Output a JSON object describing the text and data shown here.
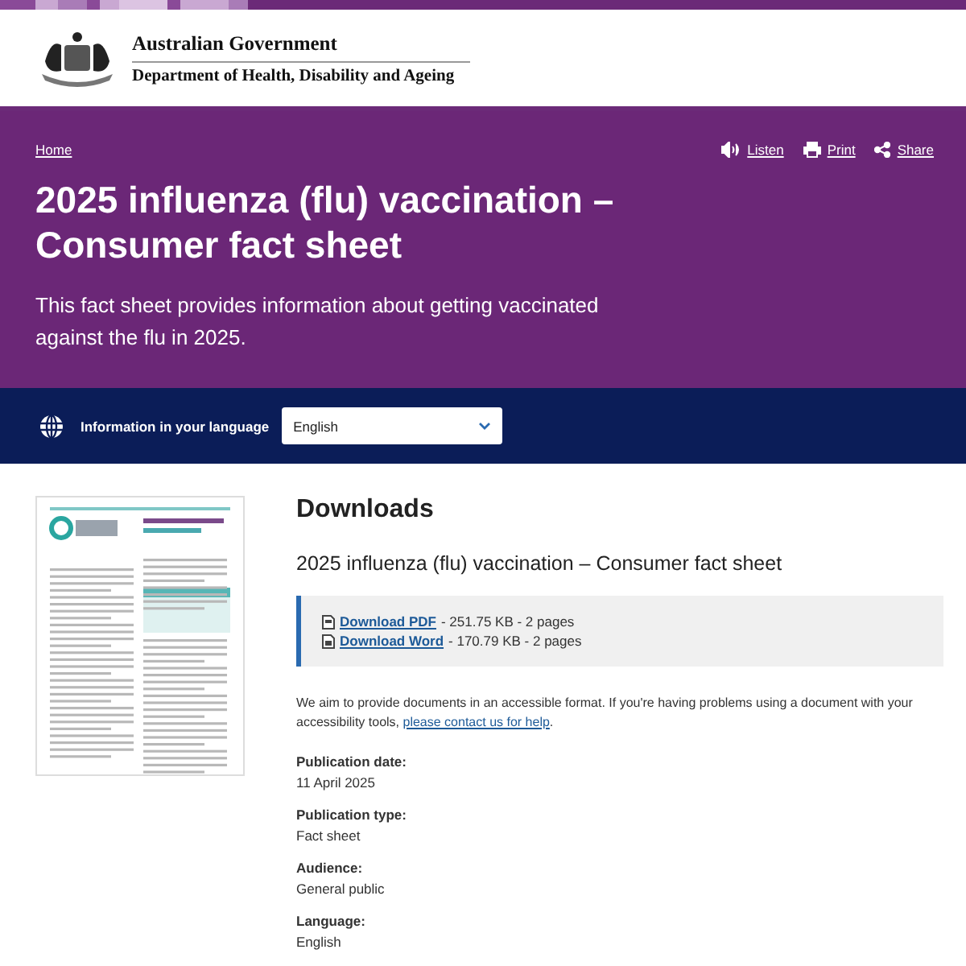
{
  "header": {
    "line_1": "Australian Government",
    "line_2": "Department of Health, Disability and Ageing"
  },
  "hero": {
    "breadcrumb": "Home",
    "actions": [
      {
        "kind": "listen",
        "label": "Listen"
      },
      {
        "kind": "print",
        "label": "Print"
      },
      {
        "kind": "share",
        "label": "Share"
      }
    ],
    "title": "2025 influenza (flu) vaccination – Consumer fact sheet",
    "summary": "This fact sheet provides information about getting vaccinated against the flu in 2025."
  },
  "language_bar": {
    "label": "Information in your language",
    "select": {
      "value": "English"
    }
  },
  "downloads": {
    "heading": "Downloads",
    "subtitle": "2025 influenza (flu) vaccination – Consumer fact sheet",
    "files": [
      {
        "kind": "pdf",
        "link": "Download PDF",
        "details": " - 251.75 KB - 2 pages"
      },
      {
        "kind": "word",
        "link": "Download Word",
        "details": " - 170.79 KB - 2 pages"
      }
    ]
  },
  "accessibility_note": {
    "text": "We aim to provide documents in an accessible format. If you're having problems using a document with your accessibility tools, ",
    "link": "please contact us for help",
    "end": "."
  },
  "metadata": [
    {
      "label": "Publication date:",
      "value": "11 April 2025"
    },
    {
      "label": "Publication type:",
      "value": "Fact sheet"
    },
    {
      "label": "Audience:",
      "value": "General public"
    },
    {
      "label": "Language:",
      "value": "English"
    }
  ]
}
